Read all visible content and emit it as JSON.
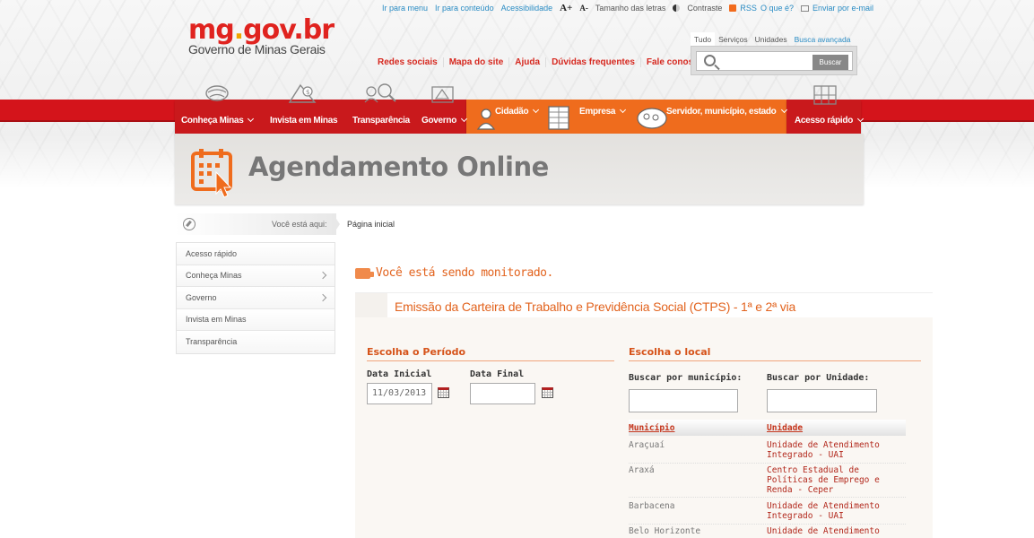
{
  "utility": {
    "skip_menu": "Ir para menu",
    "skip_content": "Ir para conteúdo",
    "accessibility": "Acessibilidade",
    "font_up": "A+",
    "font_down": "A-",
    "font_size": "Tamanho das letras",
    "contrast": "Contraste",
    "rss": "RSS",
    "rss_what": "O que é?",
    "email": "Enviar por e-mail"
  },
  "logo": {
    "brand_main": "mg",
    "brand_dot": ".",
    "brand_rest": "gov.br",
    "subtitle": "Governo de Minas Gerais"
  },
  "toplinks": [
    "Redes sociais",
    "Mapa do site",
    "Ajuda",
    "Dúvidas frequentes",
    "Fale conosco"
  ],
  "search": {
    "tabs": [
      "Tudo",
      "Serviços",
      "Unidades"
    ],
    "advanced": "Busca avançada",
    "button": "Buscar",
    "value": ""
  },
  "nav": {
    "conheca": "Conheça Minas",
    "invista": "Invista em Minas",
    "transparencia": "Transparência",
    "governo": "Governo",
    "cidadao": "Cidadão",
    "empresa": "Empresa",
    "servidor": "Servidor, município, estado",
    "acesso": "Acesso rápido"
  },
  "header": {
    "title": "Agendamento Online"
  },
  "breadcrumb": {
    "label": "Você está aqui:",
    "current": "Página inicial"
  },
  "sidebar": {
    "items": [
      {
        "label": "Acesso rápido"
      },
      {
        "label": "Conheça Minas"
      },
      {
        "label": "Governo"
      },
      {
        "label": "Invista em Minas"
      },
      {
        "label": "Transparência"
      }
    ]
  },
  "monitor": "Você está sendo monitorado.",
  "service": {
    "title": "Emissão da Carteira de Trabalho e Previdência Social (CTPS) - 1ª e 2ª via",
    "period": {
      "title": "Escolha o Período",
      "start_label": "Data Inicial",
      "start_value": "11/03/2013",
      "end_label": "Data Final",
      "end_value": ""
    },
    "location": {
      "title": "Escolha o local",
      "by_city_label": "Buscar por município:",
      "by_unit_label": "Buscar por Unidade:",
      "by_city_value": "",
      "by_unit_value": "",
      "col_city": "Município",
      "col_unit": "Unidade",
      "rows": [
        {
          "city": "Araçuaí",
          "unit": "Unidade de Atendimento Integrado - UAI"
        },
        {
          "city": "Araxá",
          "unit": "Centro Estadual de Políticas de Emprego e Renda - Ceper"
        },
        {
          "city": "Barbacena",
          "unit": "Unidade de Atendimento Integrado - UAI"
        },
        {
          "city": "Belo Horizonte",
          "unit": "Unidade de Atendimento"
        }
      ]
    }
  },
  "colors": {
    "red": "#d4141b",
    "orange": "#ef6c1d",
    "accent_text": "#e2631e",
    "link_blue": "#2a8cc4"
  }
}
